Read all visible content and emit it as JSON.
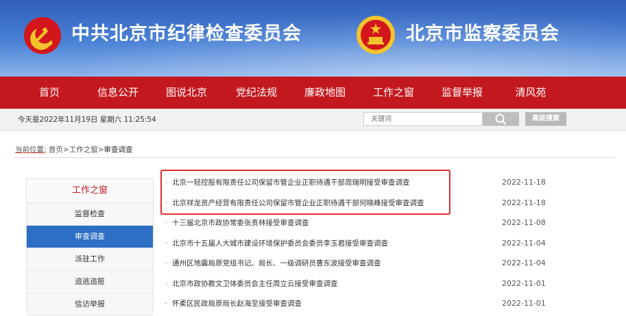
{
  "header": {
    "title_left": "中共北京市纪律检查委员会",
    "title_right": "北京市监察委员会",
    "colors": {
      "sky_top": "#2f5fb8",
      "sky_bottom": "#8cb3ea",
      "emblem_red": "#d3161b",
      "emblem_gold": "#f5c42c"
    }
  },
  "nav": {
    "color": "#c3181e",
    "items": [
      {
        "label": "首页"
      },
      {
        "label": "信息公开"
      },
      {
        "label": "图说北京"
      },
      {
        "label": "党纪法规"
      },
      {
        "label": "廉政地图"
      },
      {
        "label": "工作之窗"
      },
      {
        "label": "监督举报"
      },
      {
        "label": "清风苑"
      }
    ]
  },
  "toolbar": {
    "date_text": "今天是2022年11月19日 星期六 11:25:54",
    "search_placeholder": "关键词",
    "search_icon": "search-icon",
    "advanced_label": "高级搜索"
  },
  "breadcrumb": {
    "label": "当前位置:",
    "items": [
      "首页",
      "工作之窗",
      "审查调查"
    ],
    "separator": ">"
  },
  "sidebar": {
    "heading": "工作之窗",
    "items": [
      {
        "label": "监督检查",
        "active": false
      },
      {
        "label": "审查调查",
        "active": true
      },
      {
        "label": "派驻工作",
        "active": false
      },
      {
        "label": "追逃追赃",
        "active": false
      },
      {
        "label": "信访举报",
        "active": false
      }
    ],
    "active_color": "#2d6fc4"
  },
  "articles": [
    {
      "title": "北京一轻控股有限责任公司保留市管企业正职待遇干部周瑞明接受审查调查",
      "date": "2022-11-18"
    },
    {
      "title": "北京祥龙资产经营有限责任公司保留市管企业正职待遇干部何晓峰接受审查调查",
      "date": "2022-11-18"
    },
    {
      "title": "十三届北京市政协常委张贵林接受审查调查",
      "date": "2022-11-08"
    },
    {
      "title": "北京市十五届人大城市建设环境保护委员会委员李玉君接受审查调查",
      "date": "2022-11-04"
    },
    {
      "title": "通州区地震局原党组书记、局长、一级调研员曹东波接受审查调查",
      "date": "2022-11-04"
    },
    {
      "title": "北京市政协教文卫体委员会主任周立云接受审查调查",
      "date": "2022-11-01"
    },
    {
      "title": "怀柔区民政局原局长赵海至接受审查调查",
      "date": "2022-11-01"
    }
  ],
  "highlight_color": "#e22b2b"
}
